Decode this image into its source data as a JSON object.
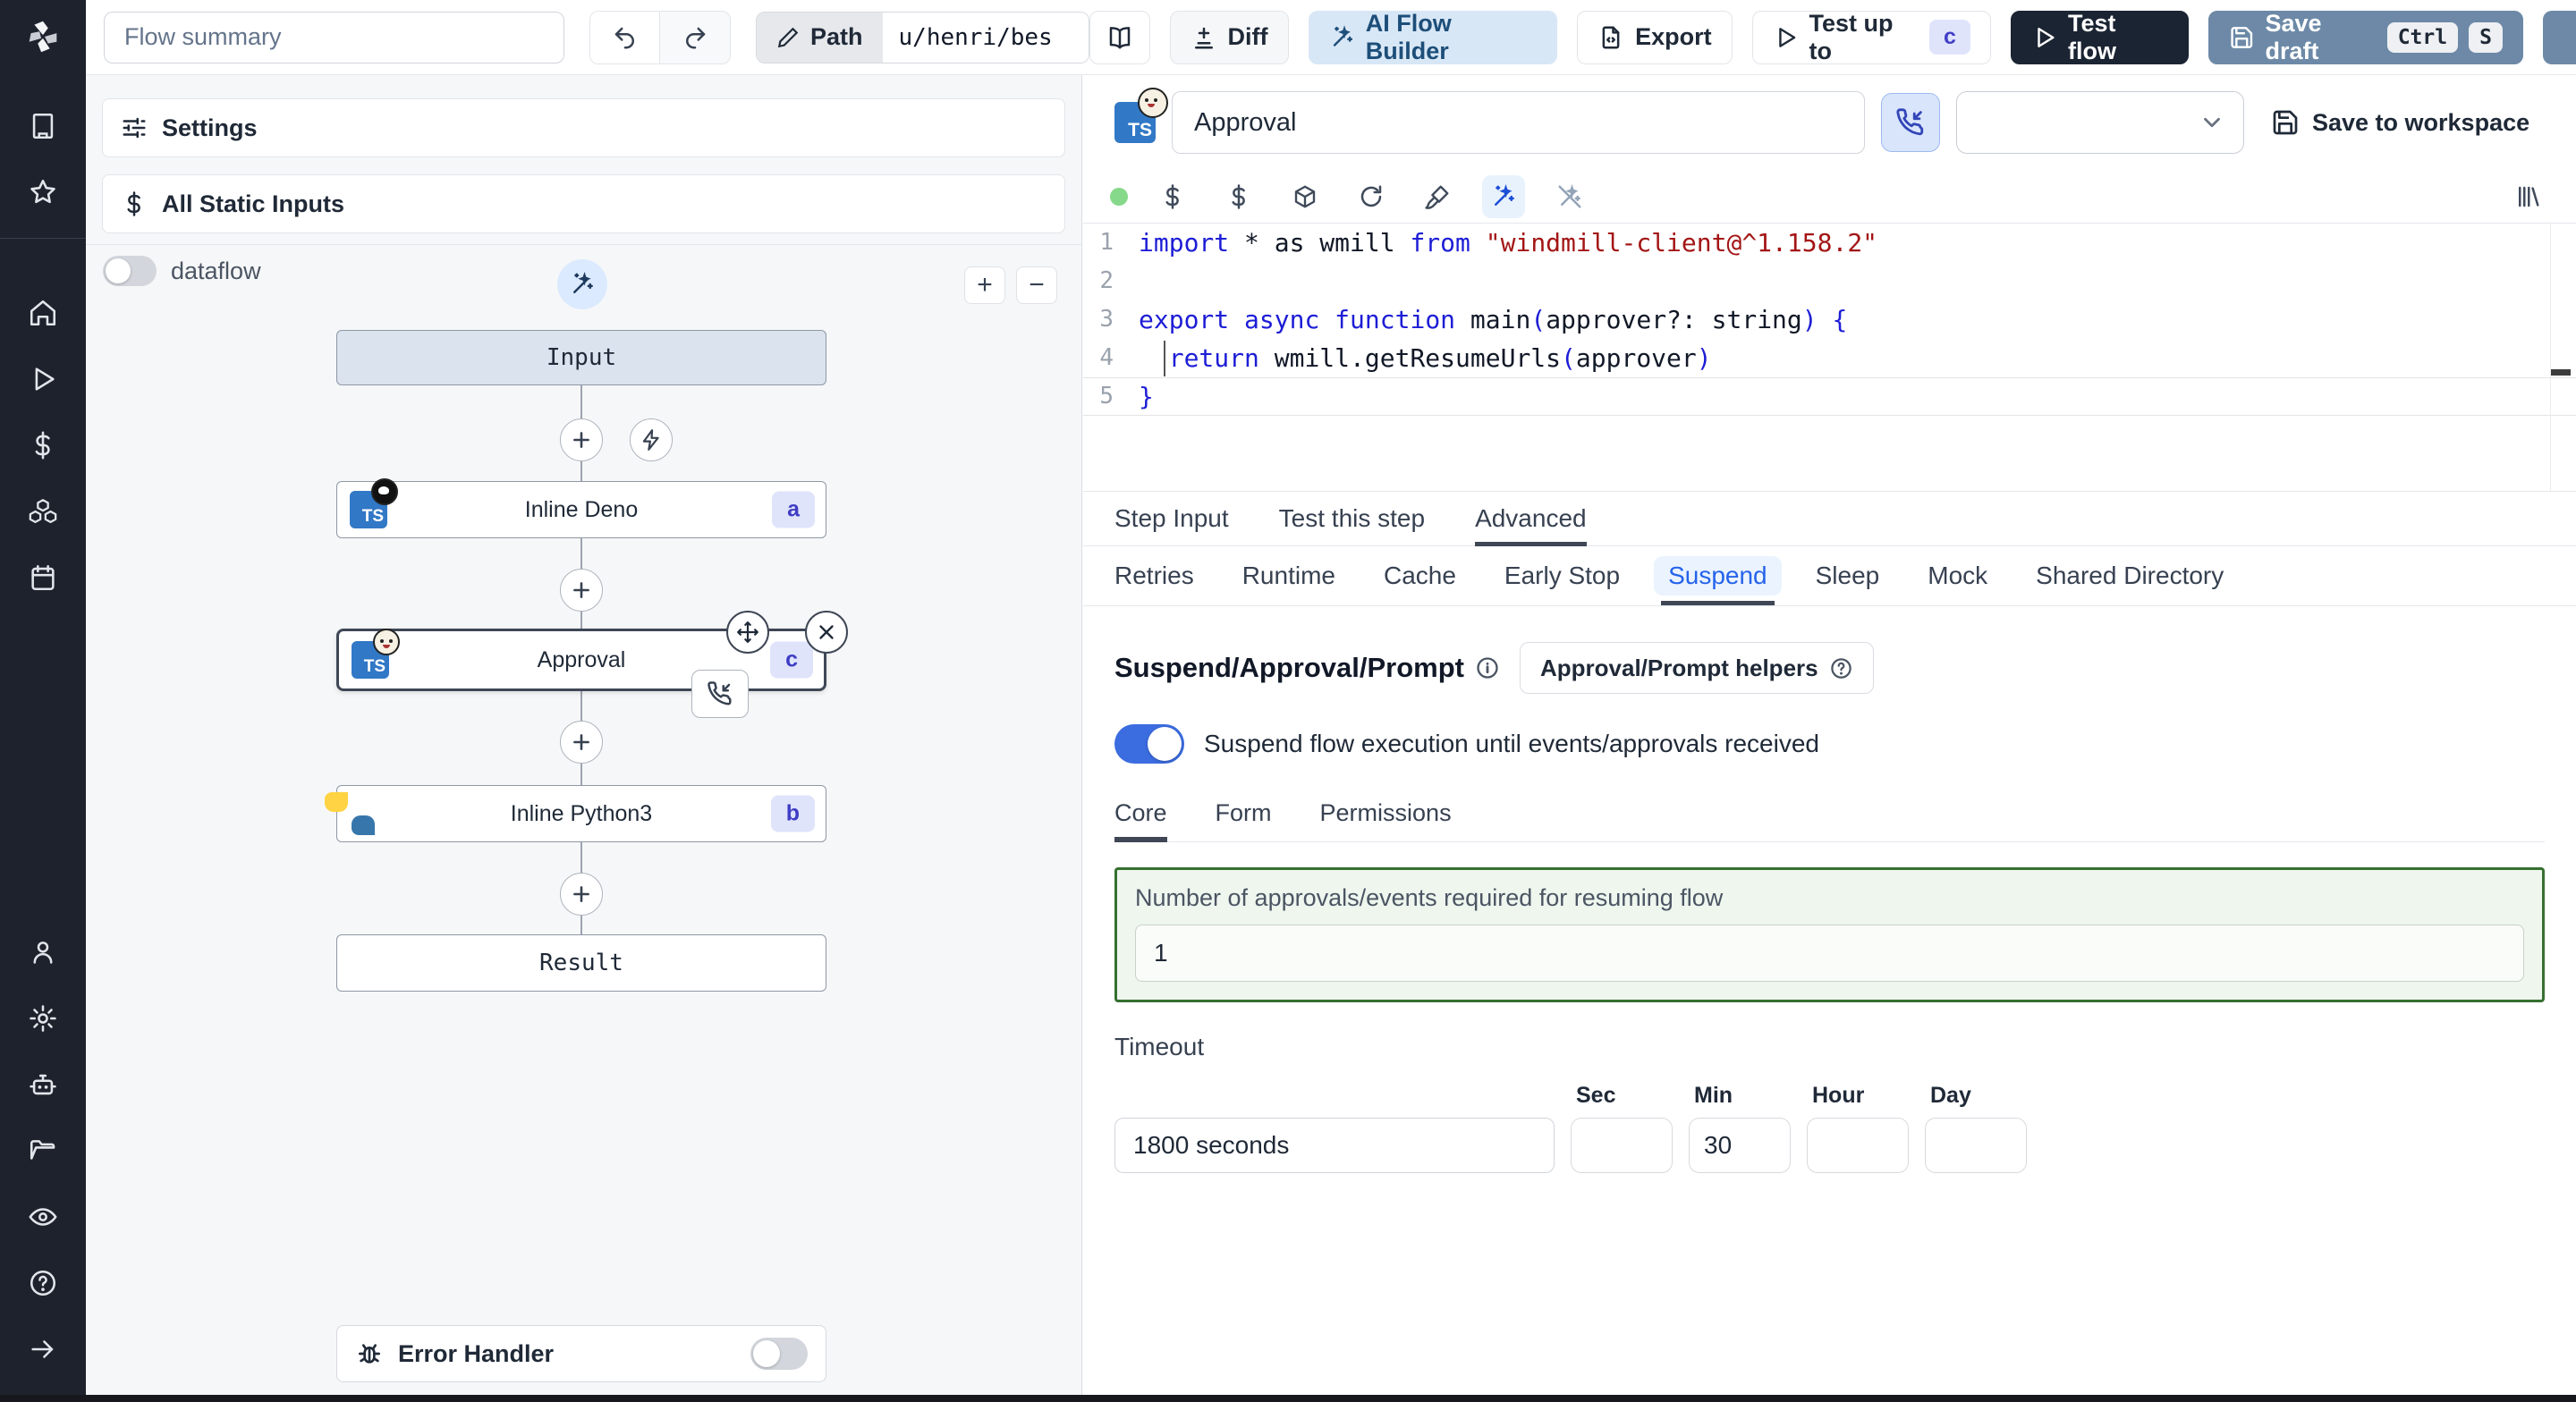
{
  "colors": {
    "accent_blue": "#3b6ce0",
    "dark_button": "#1b2433",
    "slate_button": "#6d89a7",
    "badge_bg": "#e0e4fb",
    "badge_text": "#4340c7",
    "green_border": "#35702f",
    "sidebar_bg": "#1e222d"
  },
  "topbar": {
    "flow_summary_placeholder": "Flow summary",
    "path_label": "Path",
    "path_value": "u/henri/bes",
    "diff_label": "Diff",
    "ai_flow_builder_label": "AI Flow Builder",
    "export_label": "Export",
    "test_up_to_label": "Test up to",
    "test_up_to_badge": "c",
    "test_flow_label": "Test flow",
    "save_draft_label": "Save draft",
    "save_draft_kbd": [
      "Ctrl",
      "S"
    ]
  },
  "flow_panel": {
    "settings_label": "Settings",
    "static_inputs_label": "All Static Inputs",
    "dataflow_label": "dataflow",
    "zoom_in_label": "+",
    "zoom_out_label": "−",
    "nodes": {
      "input_label": "Input",
      "deno_label": "Inline Deno",
      "deno_badge": "a",
      "approval_label": "Approval",
      "approval_badge": "c",
      "python_label": "Inline Python3",
      "python_badge": "b",
      "result_label": "Result"
    },
    "error_handler_label": "Error Handler"
  },
  "editor": {
    "step_name": "Approval",
    "save_to_workspace_label": "Save to workspace",
    "code_lines": [
      {
        "num": "1",
        "tokens": [
          {
            "t": "import",
            "c": "kw"
          },
          {
            "t": " * as wmill ",
            "c": "pl"
          },
          {
            "t": "from",
            "c": "kw"
          },
          {
            "t": " ",
            "c": "pl"
          },
          {
            "t": "\"windmill-client@^1.158.2\"",
            "c": "str"
          }
        ]
      },
      {
        "num": "2",
        "tokens": []
      },
      {
        "num": "3",
        "tokens": [
          {
            "t": "export",
            "c": "kw"
          },
          {
            "t": " ",
            "c": "pl"
          },
          {
            "t": "async",
            "c": "kw"
          },
          {
            "t": " ",
            "c": "pl"
          },
          {
            "t": "function",
            "c": "kw"
          },
          {
            "t": " main",
            "c": "pl"
          },
          {
            "t": "(",
            "c": "kw"
          },
          {
            "t": "approver?: string",
            "c": "pl"
          },
          {
            "t": ") {",
            "c": "kw"
          }
        ]
      },
      {
        "num": "4",
        "tokens": [
          {
            "t": "  ",
            "c": "pl"
          },
          {
            "t": "return",
            "c": "kw"
          },
          {
            "t": " wmill.getResumeUrls",
            "c": "pl"
          },
          {
            "t": "(",
            "c": "kw"
          },
          {
            "t": "approver",
            "c": "pl"
          },
          {
            "t": ")",
            "c": "kw"
          }
        ]
      },
      {
        "num": "5",
        "current": true,
        "tokens": [
          {
            "t": "}",
            "c": "kw"
          }
        ]
      }
    ]
  },
  "tabs": {
    "primary": [
      "Step Input",
      "Test this step",
      "Advanced"
    ],
    "primary_active": "Advanced",
    "secondary": [
      "Retries",
      "Runtime",
      "Cache",
      "Early Stop",
      "Suspend",
      "Sleep",
      "Mock",
      "Shared Directory"
    ],
    "secondary_active": "Suspend"
  },
  "suspend": {
    "heading": "Suspend/Approval/Prompt",
    "helpers_label": "Approval/Prompt helpers",
    "toggle_label": "Suspend flow execution until events/approvals received",
    "sub_tabs": [
      "Core",
      "Form",
      "Permissions"
    ],
    "sub_active": "Core",
    "approvals_label": "Number of approvals/events required for resuming flow",
    "approvals_value": "1",
    "timeout_label": "Timeout",
    "timeout_summary": "1800 seconds",
    "units": [
      "Sec",
      "Min",
      "Hour",
      "Day"
    ],
    "min_value": "30"
  }
}
